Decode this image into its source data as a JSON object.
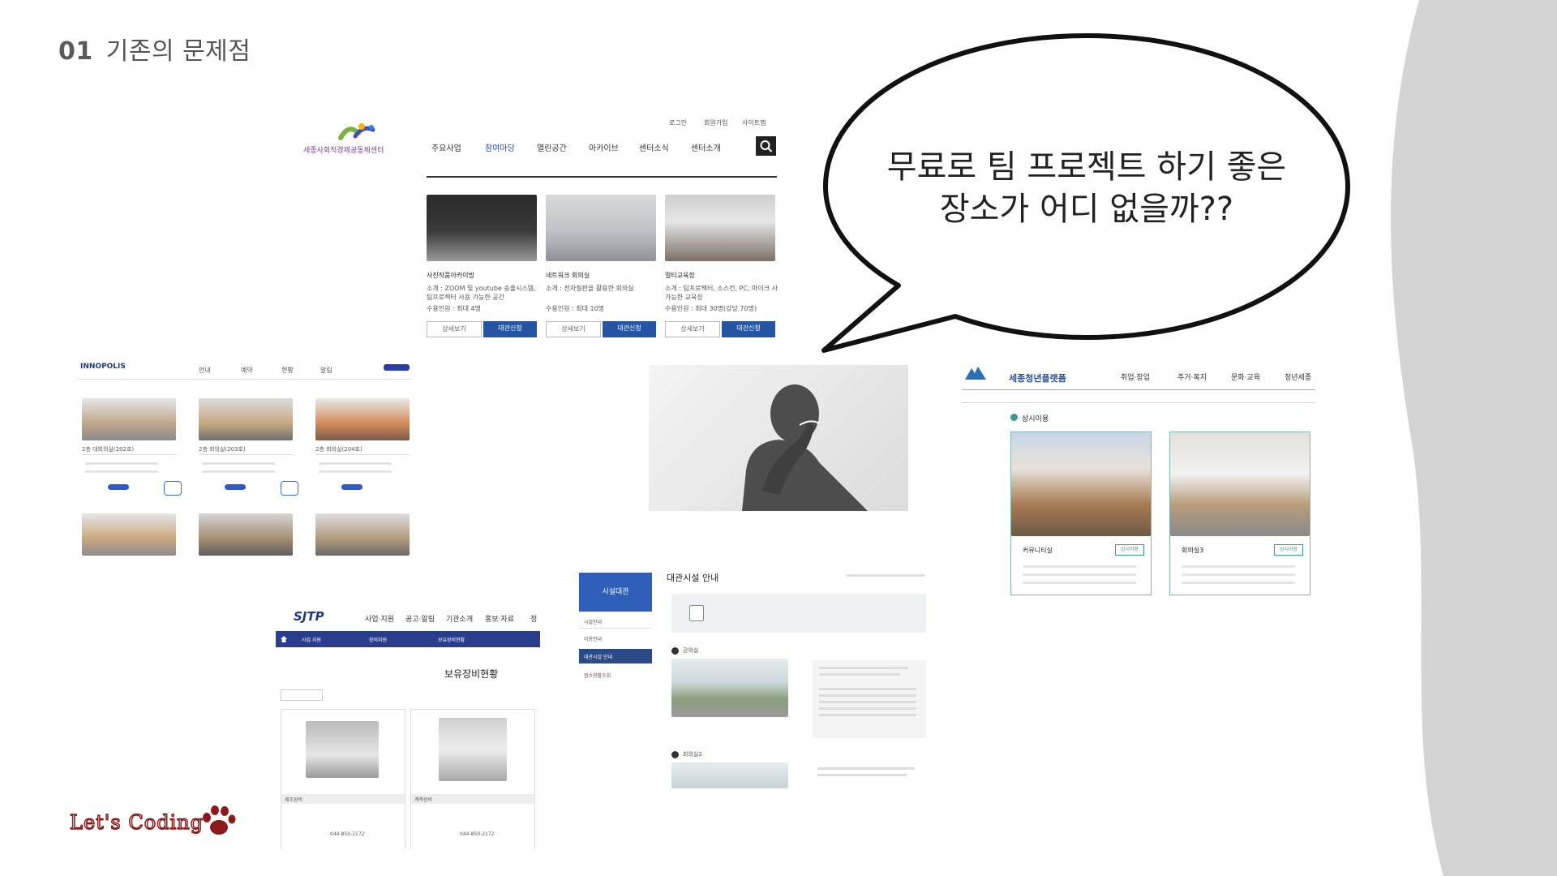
{
  "slide": {
    "number": "01",
    "title": "기존의 문제점",
    "bubble_line1": "무료로 팀 프로젝트 하기 좋은",
    "bubble_line2": "장소가 어디 없을까??",
    "logo": "Let's Coding"
  },
  "sejong_social": {
    "org_name": "세종사회적경제공동체센터",
    "util_links": [
      "로그인",
      "회원가입",
      "사이트맵"
    ],
    "nav": [
      "주요사업",
      "참여마당",
      "열린공간",
      "아카이브",
      "센터소식",
      "센터소개"
    ],
    "rooms": [
      {
        "name": "사진작품아카이빙",
        "desc1": "소개 : ZOOM 및 youtube 송출시스템,",
        "desc2": "팀프로젝터 사용 가능한 공간",
        "cap": "수용인원 : 최대 4명"
      },
      {
        "name": "네트워크 회의실",
        "desc1": "소개 : 전자칠판을 활용한 회의실",
        "desc2": "",
        "cap": "수용인원 : 최대 10명"
      },
      {
        "name": "멀티교육장",
        "desc1": "소개 : 팀프로젝터, 소스컨, PC, 마이크 사용",
        "desc2": "가능한 교육장",
        "cap": "수용인원 : 최대 30명(강당 70명)"
      }
    ],
    "btn_detail": "상세보기",
    "btn_rent": "대관신청"
  },
  "innopolis": {
    "logo": "INNOPOLIS",
    "nav": [
      "안내",
      "예약",
      "현황",
      "알림"
    ],
    "rooms": [
      "2층 대회의실(202호)",
      "2층 회의실(203호)",
      "2층 회의실(204호)"
    ]
  },
  "youth_platform": {
    "brand": "세종청년플랫폼",
    "nav": [
      "취업·창업",
      "주거·복지",
      "문화·교육",
      "청년세종"
    ],
    "section": "상시이용",
    "rooms": [
      "커뮤니티실",
      "회의실3"
    ],
    "btn": "상시이용"
  },
  "sjtp": {
    "logo": "SJTP",
    "nav": [
      "사업·지원",
      "공고·알림",
      "기관소개",
      "홍보·자료",
      "정"
    ],
    "filters": [
      "사업 지원",
      "장비지원",
      "보유장비현황"
    ],
    "heading": "보유장비현황",
    "items": [
      {
        "name": "제조장비",
        "phone": "044-850-2172"
      },
      {
        "name": "계측장비",
        "phone": "044-850-2172"
      }
    ]
  },
  "facility": {
    "sidebar_head": "시설대관",
    "sidebar_items": [
      "시설안내",
      "이용안내",
      "대관시설 안내",
      "접수현황조회"
    ],
    "heading": "대관시설 안내",
    "sections": [
      "강의실",
      "회의실2"
    ]
  },
  "colors": {
    "accent_blue": "#2455a4",
    "bubble_border": "#111111",
    "wave": "#d4d4d4",
    "logo_red": "#8b1a1a"
  }
}
